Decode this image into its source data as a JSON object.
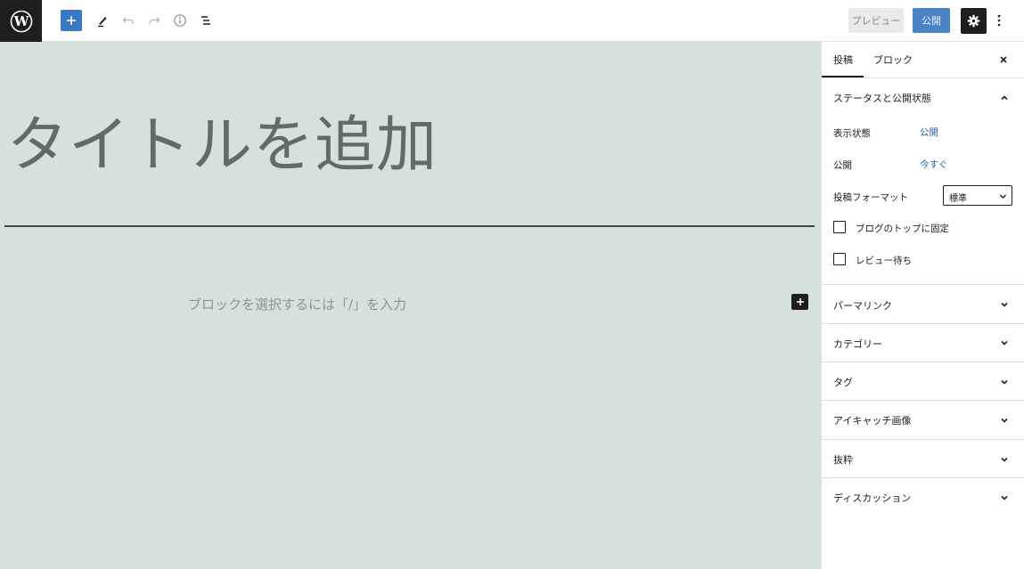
{
  "toolbar": {
    "preview_label": "プレビュー",
    "publish_label": "公開"
  },
  "editor": {
    "title_placeholder": "タイトルを追加",
    "block_placeholder": "ブロックを選択するには「/」を入力"
  },
  "sidebar": {
    "tabs": [
      {
        "label": "投稿"
      },
      {
        "label": "ブロック"
      }
    ],
    "status_panel": {
      "title": "ステータスと公開状態",
      "visibility_label": "表示状態",
      "visibility_value": "公開",
      "publish_label": "公開",
      "publish_value": "今すぐ",
      "format_label": "投稿フォーマット",
      "format_value": "標準",
      "sticky_label": "ブログのトップに固定",
      "pending_label": "レビュー待ち"
    },
    "panels": [
      {
        "title": "パーマリンク"
      },
      {
        "title": "カテゴリー"
      },
      {
        "title": "タグ"
      },
      {
        "title": "アイキャッチ画像"
      },
      {
        "title": "抜粋"
      },
      {
        "title": "ディスカッション"
      }
    ]
  },
  "colors": {
    "canvas_bg": "#d5e2dc",
    "accent": "#3b78c3",
    "link": "#2e5fa3"
  }
}
